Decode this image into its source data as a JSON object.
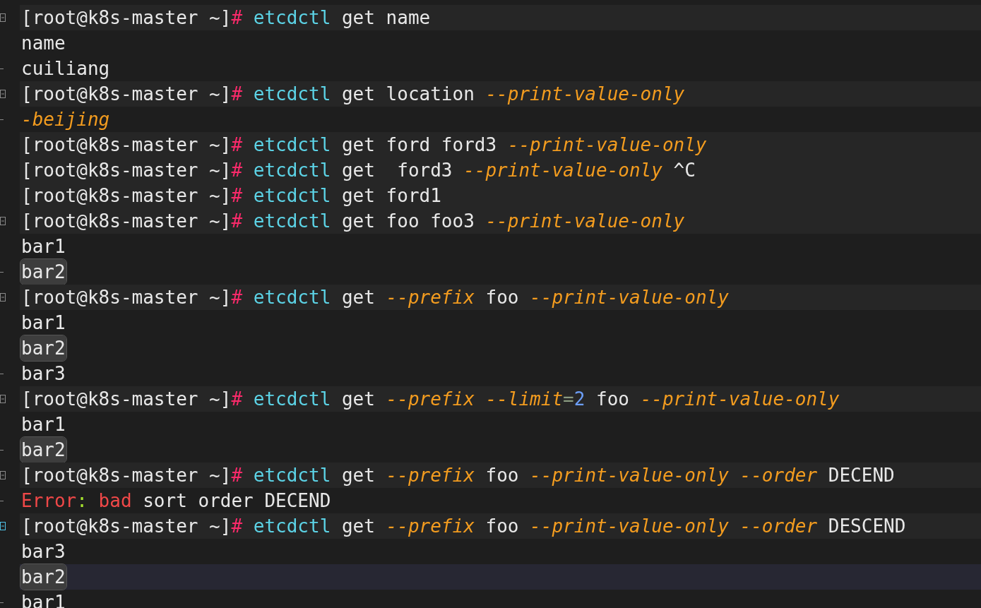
{
  "lines": [
    {
      "kind": "prompt",
      "fold_start": true,
      "fold_end": false,
      "fold_hover": false,
      "highlighted": false,
      "current": false,
      "segments": [
        {
          "kind": "prompt",
          "text": "[root@k8s-master ~]"
        },
        {
          "kind": "hash",
          "text": "#"
        },
        {
          "kind": "command",
          "text": " etcdctl"
        },
        {
          "kind": "plain",
          "text": " get name"
        }
      ]
    },
    {
      "kind": "output",
      "fold_start": false,
      "fold_end": false,
      "highlighted": false,
      "current": false,
      "segments": [
        {
          "kind": "plain",
          "text": "name"
        }
      ]
    },
    {
      "kind": "output",
      "fold_start": false,
      "fold_end": true,
      "fold_hover": false,
      "highlighted": false,
      "current": false,
      "segments": [
        {
          "kind": "plain",
          "text": "cuiliang"
        }
      ]
    },
    {
      "kind": "prompt",
      "fold_start": true,
      "fold_end": false,
      "fold_hover": false,
      "highlighted": false,
      "current": false,
      "segments": [
        {
          "kind": "prompt",
          "text": "[root@k8s-master ~]"
        },
        {
          "kind": "hash",
          "text": "#"
        },
        {
          "kind": "command",
          "text": " etcdctl"
        },
        {
          "kind": "plain",
          "text": " get location "
        },
        {
          "kind": "flag",
          "text": "--print-value-only"
        }
      ]
    },
    {
      "kind": "output",
      "fold_start": false,
      "fold_end": true,
      "fold_hover": false,
      "highlighted": false,
      "current": false,
      "segments": [
        {
          "kind": "flag",
          "text": "-beijing"
        }
      ]
    },
    {
      "kind": "prompt",
      "fold_start": false,
      "fold_end": false,
      "highlighted": false,
      "current": false,
      "segments": [
        {
          "kind": "prompt",
          "text": "[root@k8s-master ~]"
        },
        {
          "kind": "hash",
          "text": "#"
        },
        {
          "kind": "command",
          "text": " etcdctl"
        },
        {
          "kind": "plain",
          "text": " get ford ford3 "
        },
        {
          "kind": "flag",
          "text": "--print-value-only"
        }
      ]
    },
    {
      "kind": "prompt",
      "fold_start": false,
      "fold_end": false,
      "highlighted": false,
      "current": false,
      "segments": [
        {
          "kind": "prompt",
          "text": "[root@k8s-master ~]"
        },
        {
          "kind": "hash",
          "text": "#"
        },
        {
          "kind": "command",
          "text": " etcdctl"
        },
        {
          "kind": "plain",
          "text": " get  ford3 "
        },
        {
          "kind": "flag",
          "text": "--print-value-only"
        },
        {
          "kind": "plain",
          "text": " ^C"
        }
      ]
    },
    {
      "kind": "prompt",
      "fold_start": false,
      "fold_end": false,
      "highlighted": false,
      "current": false,
      "segments": [
        {
          "kind": "prompt",
          "text": "[root@k8s-master ~]"
        },
        {
          "kind": "hash",
          "text": "#"
        },
        {
          "kind": "command",
          "text": " etcdctl"
        },
        {
          "kind": "plain",
          "text": " get ford1"
        }
      ]
    },
    {
      "kind": "prompt",
      "fold_start": true,
      "fold_end": false,
      "fold_hover": false,
      "highlighted": false,
      "current": false,
      "segments": [
        {
          "kind": "prompt",
          "text": "[root@k8s-master ~]"
        },
        {
          "kind": "hash",
          "text": "#"
        },
        {
          "kind": "command",
          "text": " etcdctl"
        },
        {
          "kind": "plain",
          "text": " get foo foo3 "
        },
        {
          "kind": "flag",
          "text": "--print-value-only"
        }
      ]
    },
    {
      "kind": "output",
      "fold_start": false,
      "fold_end": false,
      "highlighted": false,
      "current": false,
      "segments": [
        {
          "kind": "plain",
          "text": "bar1"
        }
      ]
    },
    {
      "kind": "output",
      "fold_start": false,
      "fold_end": true,
      "fold_hover": false,
      "highlighted": true,
      "current": false,
      "segments": [
        {
          "kind": "plain",
          "text": "bar2"
        }
      ]
    },
    {
      "kind": "prompt",
      "fold_start": true,
      "fold_end": false,
      "fold_hover": false,
      "highlighted": false,
      "current": false,
      "segments": [
        {
          "kind": "prompt",
          "text": "[root@k8s-master ~]"
        },
        {
          "kind": "hash",
          "text": "#"
        },
        {
          "kind": "command",
          "text": " etcdctl"
        },
        {
          "kind": "plain",
          "text": " get "
        },
        {
          "kind": "flag",
          "text": "--prefix"
        },
        {
          "kind": "plain",
          "text": " foo "
        },
        {
          "kind": "flag",
          "text": "--print-value-only"
        }
      ]
    },
    {
      "kind": "output",
      "fold_start": false,
      "fold_end": false,
      "highlighted": false,
      "current": false,
      "segments": [
        {
          "kind": "plain",
          "text": "bar1"
        }
      ]
    },
    {
      "kind": "output",
      "fold_start": false,
      "fold_end": false,
      "highlighted": true,
      "current": false,
      "segments": [
        {
          "kind": "plain",
          "text": "bar2"
        }
      ]
    },
    {
      "kind": "output",
      "fold_start": false,
      "fold_end": true,
      "fold_hover": false,
      "highlighted": false,
      "current": false,
      "segments": [
        {
          "kind": "plain",
          "text": "bar3"
        }
      ]
    },
    {
      "kind": "prompt",
      "fold_start": true,
      "fold_end": false,
      "fold_hover": false,
      "highlighted": false,
      "current": false,
      "segments": [
        {
          "kind": "prompt",
          "text": "[root@k8s-master ~]"
        },
        {
          "kind": "hash",
          "text": "#"
        },
        {
          "kind": "command",
          "text": " etcdctl"
        },
        {
          "kind": "plain",
          "text": " get "
        },
        {
          "kind": "flag",
          "text": "--prefix --limit"
        },
        {
          "kind": "operator",
          "text": "="
        },
        {
          "kind": "number",
          "text": "2"
        },
        {
          "kind": "plain",
          "text": " foo "
        },
        {
          "kind": "flag",
          "text": "--print-value-only"
        }
      ]
    },
    {
      "kind": "output",
      "fold_start": false,
      "fold_end": false,
      "highlighted": false,
      "current": false,
      "segments": [
        {
          "kind": "plain",
          "text": "bar1"
        }
      ]
    },
    {
      "kind": "output",
      "fold_start": false,
      "fold_end": true,
      "fold_hover": false,
      "highlighted": true,
      "current": false,
      "segments": [
        {
          "kind": "plain",
          "text": "bar2"
        }
      ]
    },
    {
      "kind": "prompt",
      "fold_start": true,
      "fold_end": false,
      "fold_hover": false,
      "highlighted": false,
      "current": false,
      "segments": [
        {
          "kind": "prompt",
          "text": "[root@k8s-master ~]"
        },
        {
          "kind": "hash",
          "text": "#"
        },
        {
          "kind": "command",
          "text": " etcdctl"
        },
        {
          "kind": "plain",
          "text": " get "
        },
        {
          "kind": "flag",
          "text": "--prefix"
        },
        {
          "kind": "plain",
          "text": " foo "
        },
        {
          "kind": "flag",
          "text": "--print-value-only --order"
        },
        {
          "kind": "plain",
          "text": " DECEND"
        }
      ]
    },
    {
      "kind": "output",
      "fold_start": false,
      "fold_end": true,
      "fold_hover": false,
      "highlighted": false,
      "current": false,
      "segments": [
        {
          "kind": "error",
          "text": "Error"
        },
        {
          "kind": "punct",
          "text": ":"
        },
        {
          "kind": "error",
          "text": " bad"
        },
        {
          "kind": "plain",
          "text": " sort order DECEND"
        }
      ]
    },
    {
      "kind": "prompt",
      "fold_start": true,
      "fold_end": false,
      "fold_hover": true,
      "highlighted": false,
      "current": false,
      "segments": [
        {
          "kind": "prompt",
          "text": "[root@k8s-master ~]"
        },
        {
          "kind": "hash",
          "text": "#"
        },
        {
          "kind": "command",
          "text": " etcdctl"
        },
        {
          "kind": "plain",
          "text": " get "
        },
        {
          "kind": "flag",
          "text": "--prefix"
        },
        {
          "kind": "plain",
          "text": " foo "
        },
        {
          "kind": "flag",
          "text": "--print-value-only --order"
        },
        {
          "kind": "plain",
          "text": " DESCEND"
        }
      ]
    },
    {
      "kind": "output",
      "fold_start": false,
      "fold_end": false,
      "highlighted": false,
      "current": false,
      "segments": [
        {
          "kind": "plain",
          "text": "bar3"
        }
      ]
    },
    {
      "kind": "output",
      "fold_start": false,
      "fold_end": false,
      "highlighted": true,
      "current": true,
      "segments": [
        {
          "kind": "plain",
          "text": "bar2"
        }
      ]
    },
    {
      "kind": "output",
      "fold_start": false,
      "fold_end": true,
      "fold_hover": false,
      "highlighted": false,
      "current": false,
      "segments": [
        {
          "kind": "plain",
          "text": "bar1"
        }
      ]
    }
  ]
}
